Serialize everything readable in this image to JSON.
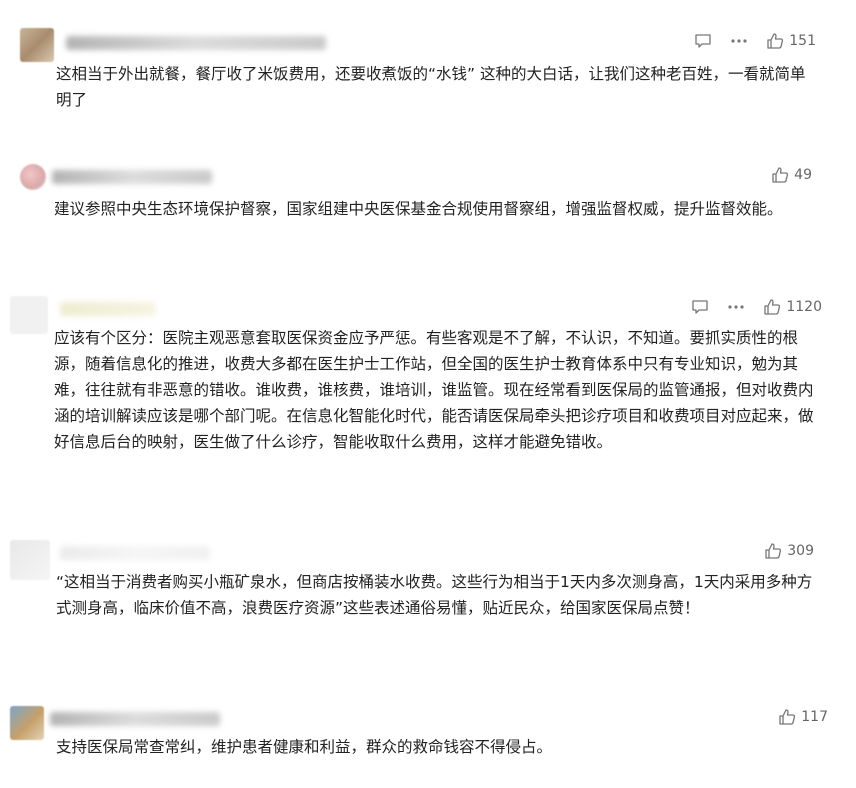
{
  "comments": [
    {
      "likes": "151",
      "show_reply_more": true,
      "text": "这相当于外出就餐，餐厅收了米饭费用，还要收煮饭的“水钱” 这种的大白话，让我们这种老百姓，一看就简单明了"
    },
    {
      "likes": "49",
      "show_reply_more": false,
      "text": "建议参照中央生态环境保护督察，国家组建中央医保基金合规使用督察组，增强监督权威，提升监督效能。"
    },
    {
      "likes": "1120",
      "show_reply_more": true,
      "text": "应该有个区分：医院主观恶意套取医保资金应予严惩。有些客观是不了解，不认识，不知道。要抓实质性的根源，随着信息化的推进，收费大多都在医生护士工作站，但全国的医生护士教育体系中只有专业知识，勉为其难，往往就有非恶意的错收。谁收费，谁核费，谁培训，谁监管。现在经常看到医保局的监管通报，但对收费内涵的培训解读应该是哪个部门呢。在信息化智能化时代，能否请医保局牵头把诊疗项目和收费项目对应起来，做好信息后台的映射，医生做了什么诊疗，智能收取什么费用，这样才能避免错收。"
    },
    {
      "likes": "309",
      "show_reply_more": false,
      "text": "“这相当于消费者购买小瓶矿泉水，但商店按桶装水收费。这些行为相当于1天内多次测身高，1天内采用多种方式测身高，临床价值不高，浪费医疗资源”这些表述通俗易懂，贴近民众，给国家医保局点赞！"
    },
    {
      "likes": "117",
      "show_reply_more": false,
      "text": "支持医保局常查常纠，维护患者健康和利益，群众的救命钱容不得侵占。"
    }
  ],
  "icons": {
    "reply": "comment-bubble-icon",
    "more": "ellipsis-icon",
    "like": "thumbs-up-icon"
  },
  "colors": {
    "text": "#222222",
    "meta": "#666666",
    "background": "#ffffff"
  }
}
